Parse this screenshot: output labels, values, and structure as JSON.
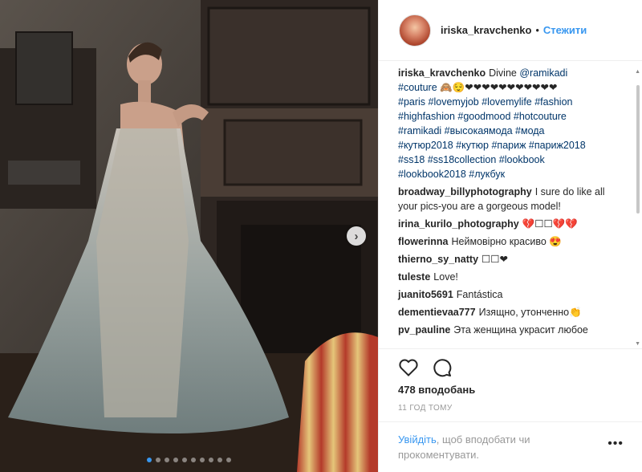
{
  "header": {
    "username": "iriska_kravchenko",
    "separator": "•",
    "follow_label": "Стежити"
  },
  "caption": {
    "username": "iriska_kravchenko",
    "text": "Divine",
    "mention": "@ramikadi",
    "line1_tag": "#couture",
    "line1_emoji": "🙈😌❤❤❤❤❤❤❤❤❤❤❤",
    "lines": [
      "#paris #lovemyjob #lovemylife #fashion",
      "#highfashion #goodmood #hotcouture",
      "#ramikadi #высокаямода #мода",
      "#кутюр2018 #кутюр #париж #париж2018",
      "#ss18 #ss18collection #lookbook",
      "#lookbook2018 #лукбук"
    ]
  },
  "comments": [
    {
      "user": "broadway_billyphotography",
      "text": "I sure do like all your pics-you are a gorgeous model!"
    },
    {
      "user": "irina_kurilo_photography",
      "text": "💔☐☐💔💔"
    },
    {
      "user": "flowerinna",
      "text": "Неймовірно красиво 😍"
    },
    {
      "user": "thierno_sy_natty",
      "text": "☐☐❤"
    },
    {
      "user": "tuleste",
      "text": "Love!"
    },
    {
      "user": "juanito5691",
      "text": "Fantástica"
    },
    {
      "user": "dementievaa777",
      "text": "Изящно, утонченно👏"
    },
    {
      "user": "pv_pauline",
      "text": "Эта женщина украсит любое"
    }
  ],
  "likes": "478 вподобань",
  "timestamp": "11 год тому",
  "login": {
    "link": "Увійдіть",
    "text": ", щоб вподобати чи прокоментувати."
  },
  "more_label": "•••",
  "next_arrow": "›",
  "carousel": {
    "total": 10,
    "active": 0
  },
  "colors": {
    "accent": "#3897f0",
    "hashtag": "#003569",
    "muted": "#999999"
  },
  "icons": [
    "heart-icon",
    "comment-icon",
    "chevron-right-icon",
    "more-options-icon"
  ]
}
